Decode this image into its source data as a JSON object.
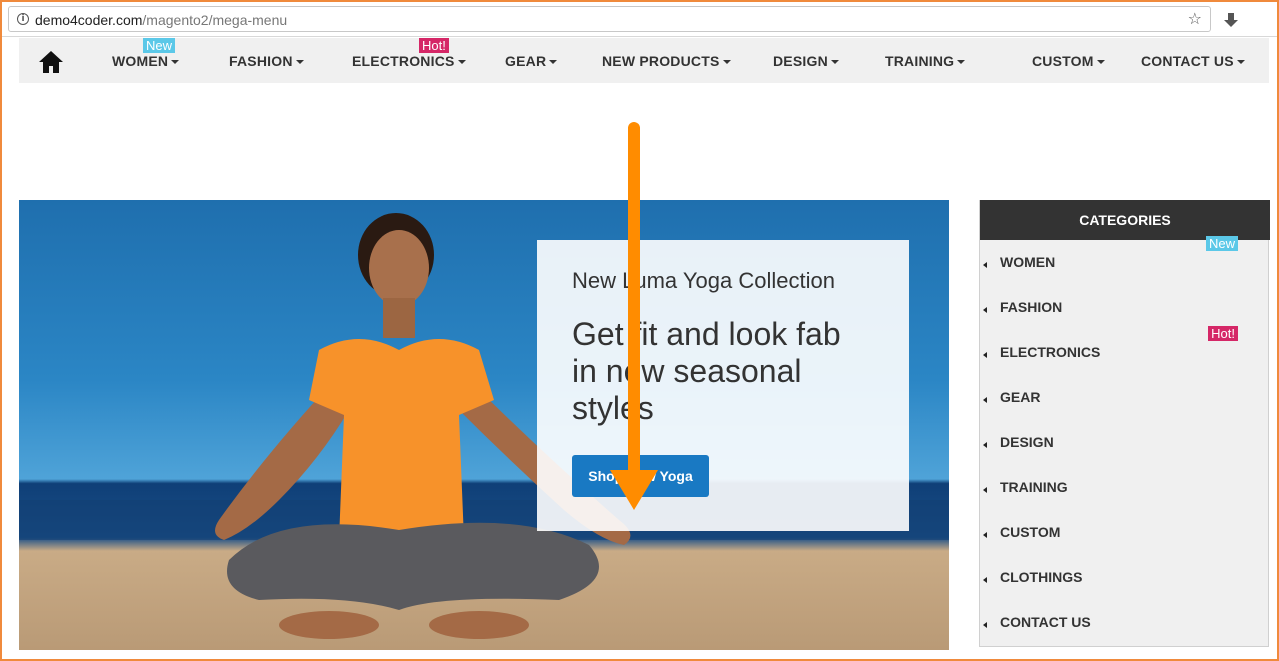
{
  "browser": {
    "url_host": "demo4coder.com",
    "url_path": "/magento2/mega-menu"
  },
  "nav": {
    "items": [
      {
        "label": "WOMEN",
        "badge": "New"
      },
      {
        "label": "FASHION"
      },
      {
        "label": "ELECTRONICS",
        "badge": "Hot!"
      },
      {
        "label": "GEAR"
      },
      {
        "label": "NEW PRODUCTS"
      },
      {
        "label": "DESIGN"
      },
      {
        "label": "TRAINING"
      },
      {
        "label": "CUSTOM"
      },
      {
        "label": "CONTACT US"
      }
    ]
  },
  "hero": {
    "subtitle": "New Luma Yoga Collection",
    "title": "Get fit and look fab in new seasonal styles",
    "button": "Shop New Yoga"
  },
  "categories": {
    "header": "CATEGORIES",
    "items": [
      {
        "label": "WOMEN",
        "badge": "New"
      },
      {
        "label": "FASHION"
      },
      {
        "label": "ELECTRONICS",
        "badge": "Hot!"
      },
      {
        "label": "GEAR"
      },
      {
        "label": "DESIGN"
      },
      {
        "label": "TRAINING"
      },
      {
        "label": "CUSTOM"
      },
      {
        "label": "CLOTHINGS"
      },
      {
        "label": "CONTACT US"
      }
    ]
  },
  "colors": {
    "frame": "#f08a3c",
    "badge_new": "#5bc8e8",
    "badge_hot": "#d52767",
    "button": "#1979c3",
    "arrow": "#ff8c00"
  }
}
